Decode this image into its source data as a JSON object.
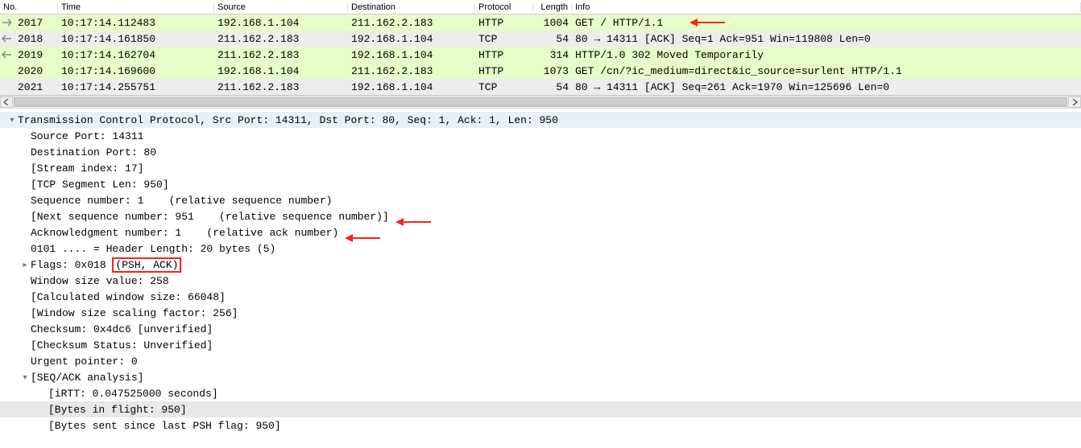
{
  "columns": {
    "no": "No.",
    "time": "Time",
    "source": "Source",
    "destination": "Destination",
    "protocol": "Protocol",
    "length": "Length",
    "info": "Info"
  },
  "packets": [
    {
      "no": "2017",
      "time": "10:17:14.112483",
      "src": "192.168.1.104",
      "dst": "211.162.2.183",
      "proto": "HTTP",
      "len": "1004",
      "info": "GET / HTTP/1.1",
      "cls": "green",
      "mark": "out",
      "redarrow": true
    },
    {
      "no": "2018",
      "time": "10:17:14.161850",
      "src": "211.162.2.183",
      "dst": "192.168.1.104",
      "proto": "TCP",
      "len": "54",
      "info": "80 → 14311 [ACK] Seq=1 Ack=951 Win=119808 Len=0",
      "cls": "gray",
      "mark": "in"
    },
    {
      "no": "2019",
      "time": "10:17:14.162704",
      "src": "211.162.2.183",
      "dst": "192.168.1.104",
      "proto": "HTTP",
      "len": "314",
      "info": "HTTP/1.0 302 Moved Temporarily",
      "cls": "green",
      "mark": "in"
    },
    {
      "no": "2020",
      "time": "10:17:14.169600",
      "src": "192.168.1.104",
      "dst": "211.162.2.183",
      "proto": "HTTP",
      "len": "1073",
      "info": "GET /cn/?ic_medium=direct&ic_source=surlent HTTP/1.1",
      "cls": "green",
      "mark": "none"
    },
    {
      "no": "2021",
      "time": "10:17:14.255751",
      "src": "211.162.2.183",
      "dst": "192.168.1.104",
      "proto": "TCP",
      "len": "54",
      "info": "80 → 14311 [ACK] Seq=261 Ack=1970 Win=125696 Len=0",
      "cls": "gray",
      "mark": "none"
    }
  ],
  "details": {
    "header": "Transmission Control Protocol, Src Port: 14311, Dst Port: 80, Seq: 1, Ack: 1, Len: 950",
    "lines": [
      "Source Port: 14311",
      "Destination Port: 80",
      "[Stream index: 17]",
      "[TCP Segment Len: 950]",
      "Sequence number: 1    (relative sequence number)",
      "[Next sequence number: 951    (relative sequence number)]",
      "Acknowledgment number: 1    (relative ack number)",
      "0101 .... = Header Length: 20 bytes (5)"
    ],
    "flags_prefix": "Flags: 0x018 ",
    "flags_box": "(PSH, ACK)",
    "lines2": [
      "Window size value: 258",
      "[Calculated window size: 66048]",
      "[Window size scaling factor: 256]",
      "Checksum: 0x4dc6 [unverified]",
      "[Checksum Status: Unverified]",
      "Urgent pointer: 0"
    ],
    "seqack": "[SEQ/ACK analysis]",
    "seqack_lines": [
      "[iRTT: 0.047525000 seconds]",
      "[Bytes in flight: 950]",
      "[Bytes sent since last PSH flag: 950]"
    ]
  }
}
